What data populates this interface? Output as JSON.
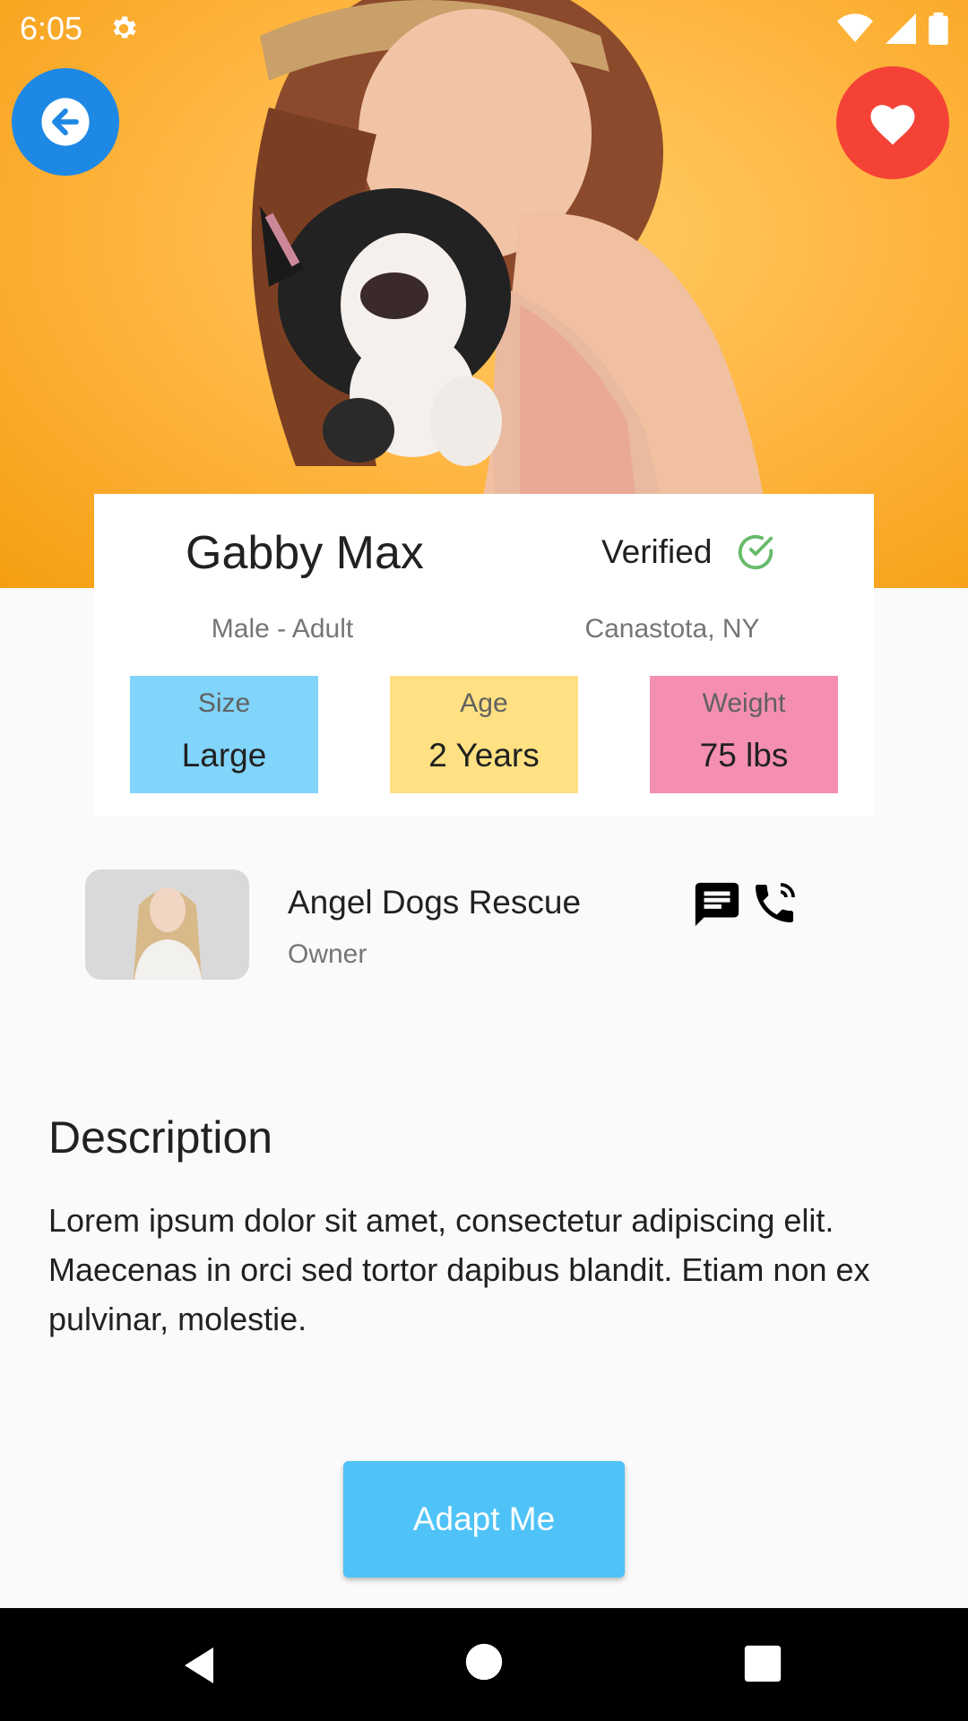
{
  "status_bar": {
    "time": "6:05",
    "icons": [
      "settings-icon",
      "wifi-icon",
      "signal-icon",
      "battery-icon"
    ]
  },
  "hero": {
    "back_icon": "arrow-left-icon",
    "favorite_icon": "heart-icon"
  },
  "pet": {
    "name": "Gabby Max",
    "verified_label": "Verified",
    "gender_age": "Male - Adult",
    "location": "Canastota, NY",
    "stats": [
      {
        "label": "Size",
        "value": "Large",
        "color": "#81d4fa"
      },
      {
        "label": "Age",
        "value": "2 Years",
        "color": "#ffe082"
      },
      {
        "label": "Weight",
        "value": "75 lbs",
        "color": "#f48fb1"
      }
    ]
  },
  "owner": {
    "name": "Angel Dogs Rescue",
    "role": "Owner",
    "actions": [
      "message-icon",
      "phone-icon"
    ]
  },
  "description": {
    "title": "Description",
    "body": "Lorem ipsum dolor sit amet, consectetur adipiscing elit. Maecenas in orci sed tortor dapibus blandit. Etiam non ex pulvinar, molestie."
  },
  "cta": {
    "label": "Adapt Me"
  },
  "colors": {
    "back_button": "#1e88e5",
    "favorite_button": "#f44336",
    "verified_check": "#66bb6a",
    "cta": "#4fc3f7",
    "hero_background": "#ffb845"
  }
}
